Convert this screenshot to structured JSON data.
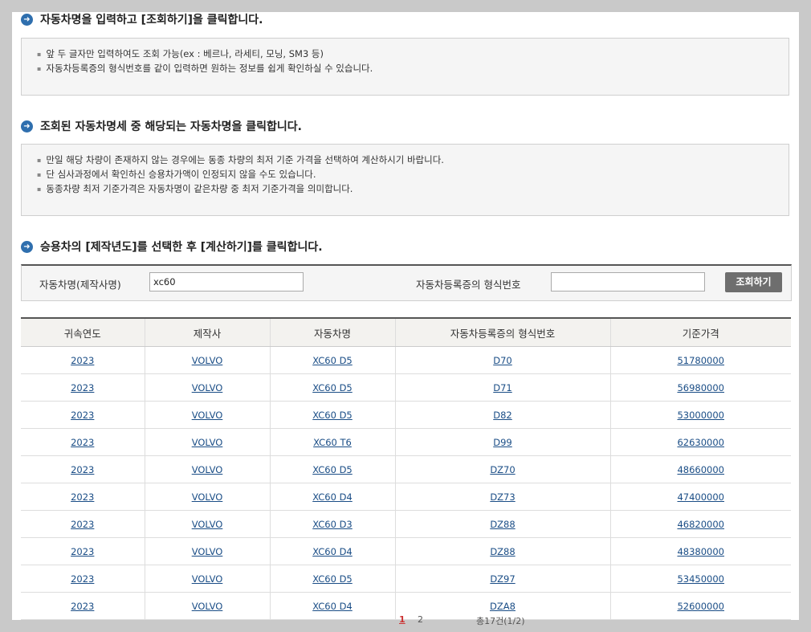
{
  "steps": {
    "step1": "자동차명을 입력하고 [조회하기]을 클릭합니다.",
    "step2": "조회된 자동차명세 중 해당되는 자동차명을 클릭합니다.",
    "step3": "승용차의 [제작년도]를 선택한 후 [계산하기]를 클릭합니다."
  },
  "notice1": [
    "앞 두 글자만 입력하여도 조회 가능(ex : 베르나, 라세티, 모닝, SM3 등)",
    "자동차등록증의 형식번호를 같이 입력하면 원하는 정보를 쉽게 확인하실 수 있습니다."
  ],
  "notice2": [
    "만일 해당 차량이 존재하지 않는 경우에는 동종 차량의 최저 기준 가격을 선택하여 계산하시기 바랍니다.",
    "단 심사과정에서 확인하신 승용차가액이 인정되지 않을 수도 있습니다.",
    "동종차량 최저 기준가격은 자동차명이 같은차량 중  최저 기준가격을 의미합니다."
  ],
  "search": {
    "car_name_label": "자동차명(제작사명)",
    "car_name_value": "xc60",
    "model_no_label": "자동차등록증의 형식번호",
    "model_no_value": "",
    "button": "조회하기"
  },
  "table": {
    "headers": [
      "귀속연도",
      "제작사",
      "자동차명",
      "자동차등록증의 형식번호",
      "기준가격"
    ],
    "rows": [
      [
        "2023",
        "VOLVO",
        "XC60 D5",
        "D70",
        "51780000"
      ],
      [
        "2023",
        "VOLVO",
        "XC60 D5",
        "D71",
        "56980000"
      ],
      [
        "2023",
        "VOLVO",
        "XC60 D5",
        "D82",
        "53000000"
      ],
      [
        "2023",
        "VOLVO",
        "XC60 T6",
        "D99",
        "62630000"
      ],
      [
        "2023",
        "VOLVO",
        "XC60 D5",
        "DZ70",
        "48660000"
      ],
      [
        "2023",
        "VOLVO",
        "XC60 D4",
        "DZ73",
        "47400000"
      ],
      [
        "2023",
        "VOLVO",
        "XC60 D3",
        "DZ88",
        "46820000"
      ],
      [
        "2023",
        "VOLVO",
        "XC60 D4",
        "DZ88",
        "48380000"
      ],
      [
        "2023",
        "VOLVO",
        "XC60 D5",
        "DZ97",
        "53450000"
      ],
      [
        "2023",
        "VOLVO",
        "XC60 D4",
        "DZA8",
        "52600000"
      ]
    ]
  },
  "pager": {
    "page1": "1",
    "page2": "2",
    "total": "총17건(1/2)"
  }
}
